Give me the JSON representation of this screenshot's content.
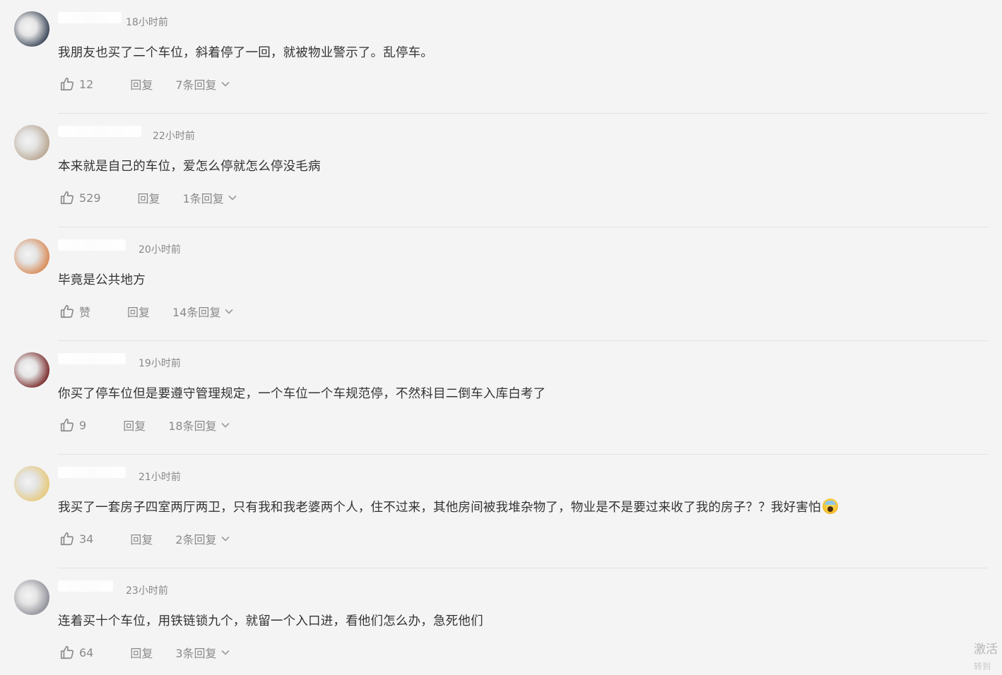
{
  "comments": [
    {
      "username": "",
      "time": "18小时前",
      "text": "我朋友也买了二个车位，斜着停了一回，就被物业警示了。乱停车。",
      "likes": "12",
      "reply_label": "回复",
      "replies_label": "7条回复",
      "avatar_color": "#3b4658"
    },
    {
      "username": "",
      "time": "22小时前",
      "text": "本来就是自己的车位，爱怎么停就怎么停没毛病",
      "likes": "529",
      "reply_label": "回复",
      "replies_label": "1条回复",
      "avatar_color": "#b9a691"
    },
    {
      "username": "",
      "time": "20小时前",
      "text": "毕竟是公共地方",
      "likes": "赞",
      "reply_label": "回复",
      "replies_label": "14条回复",
      "avatar_color": "#d98a55"
    },
    {
      "username": "",
      "time": "19小时前",
      "text": "你买了停车位但是要遵守管理规定，一个车位一个车规范停，不然科目二倒车入库白考了",
      "likes": "9",
      "reply_label": "回复",
      "replies_label": "18条回复",
      "avatar_color": "#7a2a2a"
    },
    {
      "username": "",
      "time": "21小时前",
      "text": "我买了一套房子四室两厅两卫，只有我和我老婆两个人，住不过来，其他房间被我堆杂物了，物业是不是要过来收了我的房子？？我好害怕",
      "likes": "34",
      "reply_label": "回复",
      "replies_label": "2条回复",
      "avatar_color": "#e6c97a",
      "emoji": "scream-emoji"
    },
    {
      "username": "",
      "time": "23小时前",
      "text": "连着买十个车位，用铁链锁九个，就留一个入口进，看他们怎么办，急死他们",
      "likes": "64",
      "reply_label": "回复",
      "replies_label": "3条回复",
      "avatar_color": "#8f8f99"
    }
  ],
  "icons": {
    "like": "thumbs-up-icon",
    "expand": "chevron-down-icon"
  },
  "watermark": {
    "line1": "激活",
    "line2": "转到"
  }
}
